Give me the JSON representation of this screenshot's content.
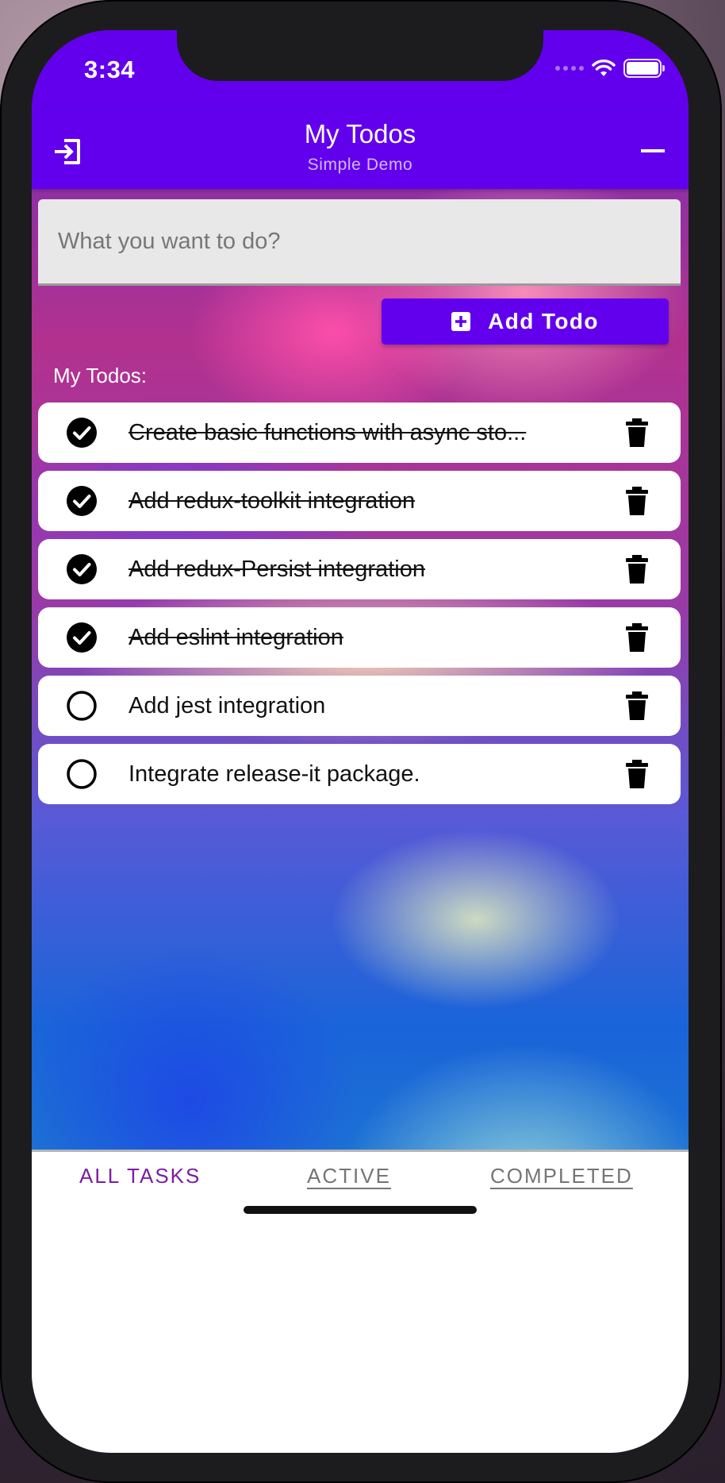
{
  "status_bar": {
    "time": "3:34"
  },
  "app_bar": {
    "title": "My Todos",
    "subtitle": "Simple Demo",
    "logout_icon": "logout-icon",
    "menu_icon": "minus-icon",
    "background_color": "#6200ee"
  },
  "new_todo": {
    "value": "",
    "placeholder": "What you want to do?",
    "add_button_label": "Add Todo",
    "add_icon": "plus-square-icon"
  },
  "list_label": "My Todos:",
  "todos": [
    {
      "text": "Create basic functions with async sto...",
      "completed": true
    },
    {
      "text": "Add redux-toolkit integration",
      "completed": true
    },
    {
      "text": "Add redux-Persist integration",
      "completed": true
    },
    {
      "text": "Add eslint integration",
      "completed": true
    },
    {
      "text": "Add jest integration",
      "completed": false
    },
    {
      "text": "Integrate release-it package.",
      "completed": false
    }
  ],
  "tabs": [
    {
      "label": "ALL TASKS",
      "active": true
    },
    {
      "label": "ACTIVE",
      "active": false
    },
    {
      "label": "COMPLETED",
      "active": false
    }
  ],
  "colors": {
    "accent": "#6200ee",
    "active_tab": "#7b1fa2",
    "inactive_tab": "#757575"
  }
}
